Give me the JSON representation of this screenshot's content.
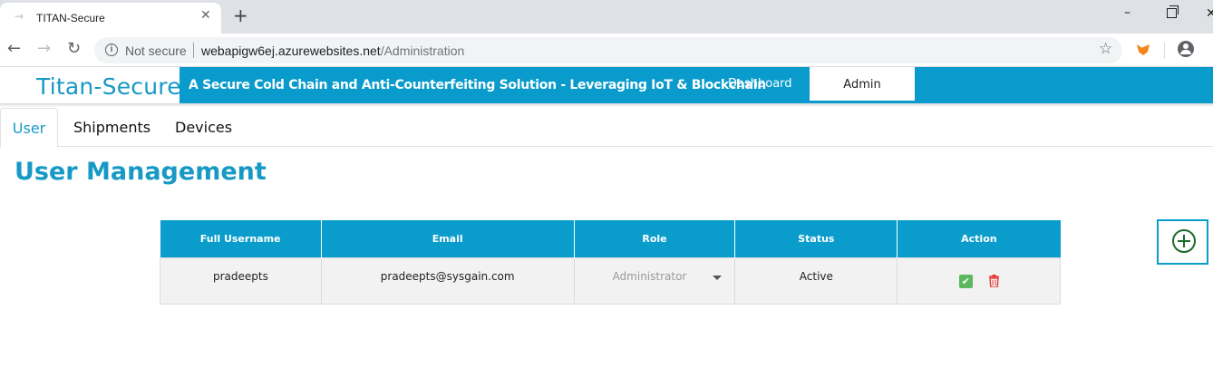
{
  "browser": {
    "tab_title": "TITAN-Secure",
    "tab_close": "✕",
    "new_tab": "+",
    "security_label": "Not secure",
    "url_host": "webapigw6ej.azurewebsites.net",
    "url_path": "/Administration"
  },
  "header": {
    "brand": "Titan-Secure",
    "tagline": "A Secure Cold Chain and Anti-Counterfeiting Solution - Leveraging IoT & Blockchain",
    "nav": {
      "dashboard": "Dashboard",
      "admin": "Admin"
    }
  },
  "subtabs": {
    "user": "User",
    "shipments": "Shipments",
    "devices": "Devices"
  },
  "page": {
    "title": "User Management"
  },
  "table": {
    "columns": [
      "Full Username",
      "Email",
      "Role",
      "Status",
      "Action"
    ],
    "rows": [
      {
        "full_username": "pradeepts",
        "email": "pradeepts@sysgain.com",
        "role": "Administrator",
        "status": "Active"
      }
    ]
  },
  "icons": {
    "approve": "check-icon",
    "delete": "trash-icon",
    "add": "add-circle-icon"
  },
  "colors": {
    "brand": "#1799c5",
    "header_band": "#089bcb",
    "approve": "#5cb85c",
    "delete": "#e53935",
    "add": "#1e6b2e"
  }
}
